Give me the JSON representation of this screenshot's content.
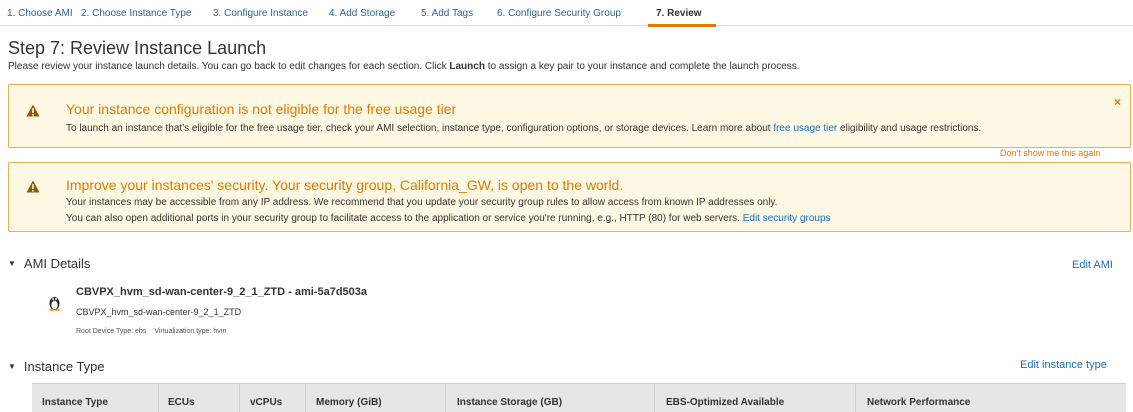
{
  "wizard": {
    "steps": [
      "1. Choose AMI",
      "2. Choose Instance Type",
      "3. Configure Instance",
      "4. Add Storage",
      "5. Add Tags",
      "6. Configure Security Group",
      "7. Review"
    ],
    "active_step": "7. Review"
  },
  "page": {
    "title": "Step 7: Review Instance Launch",
    "intro_before": "Please review your instance launch details. You can go back to edit changes for each section. Click ",
    "intro_bold": "Launch",
    "intro_after": " to assign a key pair to your instance and complete the launch process."
  },
  "alerts": {
    "free_tier": {
      "heading": "Your instance configuration is not eligible for the free usage tier",
      "body_before": "To launch an instance that's eligible for the free usage tier, check your AMI selection, instance type, configuration options, or storage devices. Learn more about ",
      "link": "free usage tier",
      "body_after": " eligibility and usage restrictions.",
      "close": "×",
      "dont_show": "Don't show me this again"
    },
    "security": {
      "heading": "Improve your instances' security. Your security group, California_GW, is open to the world.",
      "line1": "Your instances may be accessible from any IP address. We recommend that you update your security group rules to allow access from known IP addresses only.",
      "line2_before": "You can also open additional ports in your security group to facilitate access to the application or service you're running, e.g., HTTP (80) for web servers. ",
      "link": "Edit security groups"
    }
  },
  "ami": {
    "section_label": "AMI Details",
    "edit_link": "Edit AMI",
    "name": "CBVPX_hvm_sd-wan-center-9_2_1_ZTD - ami-5a7d503a",
    "description": "CBVPX_hvm_sd-wan-center-9_2_1_ZTD",
    "root_device": "Root Device Type: ebs",
    "virtualization": "Virtualization type: hvm"
  },
  "instance_type": {
    "section_label": "Instance Type",
    "edit_link": "Edit instance type",
    "columns": [
      "Instance Type",
      "ECUs",
      "vCPUs",
      "Memory (GiB)",
      "Instance Storage (GB)",
      "EBS-Optimized Available",
      "Network Performance"
    ]
  },
  "colors": {
    "warning_text": "#e07b00",
    "warning_bg": "#fcf8e3",
    "warning_border": "#f0ad4e",
    "link": "#1a6ec2"
  },
  "icons": {
    "warning": "warning-triangle-icon",
    "close": "close-icon",
    "collapse": "caret-down-icon",
    "os_logo": "linux-penguin-icon"
  }
}
